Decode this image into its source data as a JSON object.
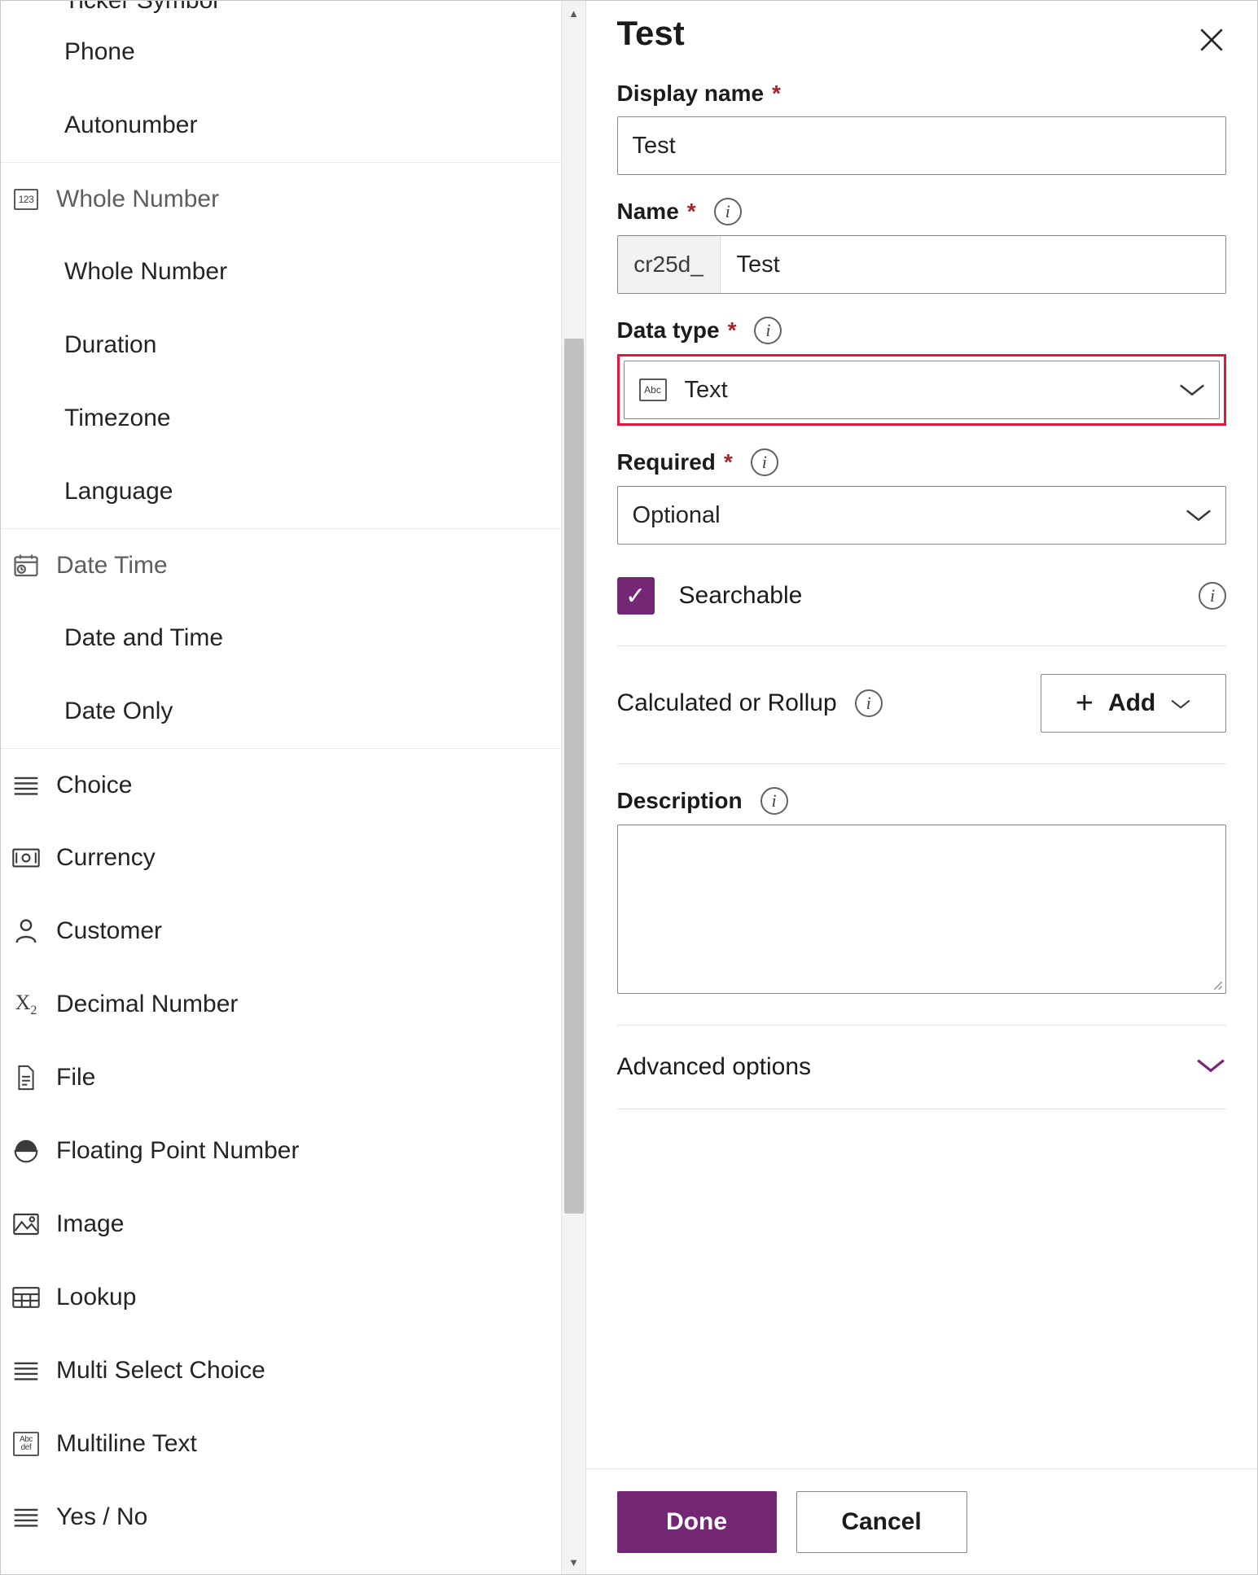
{
  "colors": {
    "accent": "#742774",
    "highlight": "#e3173e",
    "required_star": "#a4262c",
    "group_header_text": "#5e5e5e",
    "border": "#8a8886"
  },
  "left_list": {
    "name": "data-type-list",
    "partial_top_item": "Ticker Symbol",
    "sections": [
      {
        "items": [
          {
            "label": "Phone",
            "indent": true
          },
          {
            "label": "Autonumber",
            "indent": true
          }
        ]
      },
      {
        "header": {
          "label": "Whole Number",
          "icon": "whole-number-icon",
          "glyph": "123"
        },
        "items": [
          {
            "label": "Whole Number",
            "indent": true
          },
          {
            "label": "Duration",
            "indent": true
          },
          {
            "label": "Timezone",
            "indent": true
          },
          {
            "label": "Language",
            "indent": true
          }
        ]
      },
      {
        "header": {
          "label": "Date Time",
          "icon": "date-time-icon",
          "glyph": "cal"
        },
        "items": [
          {
            "label": "Date and Time",
            "indent": true
          },
          {
            "label": "Date Only",
            "indent": true
          }
        ]
      },
      {
        "items": [
          {
            "label": "Choice",
            "icon": "choice-list-icon"
          },
          {
            "label": "Currency",
            "icon": "currency-icon"
          },
          {
            "label": "Customer",
            "icon": "customer-person-icon"
          },
          {
            "label": "Decimal Number",
            "icon": "decimal-number-icon"
          },
          {
            "label": "File",
            "icon": "file-icon"
          },
          {
            "label": "Floating Point Number",
            "icon": "floating-point-icon"
          },
          {
            "label": "Image",
            "icon": "image-icon"
          },
          {
            "label": "Lookup",
            "icon": "lookup-icon"
          },
          {
            "label": "Multi Select Choice",
            "icon": "multi-select-choice-icon"
          },
          {
            "label": "Multiline Text",
            "icon": "multiline-text-icon"
          },
          {
            "label": "Yes / No",
            "icon": "yes-no-icon"
          }
        ]
      }
    ],
    "scrollbar": {
      "up_arrow": "▲",
      "down_arrow": "▼"
    }
  },
  "panel": {
    "title": "Test",
    "close_icon": "close-icon",
    "display_name": {
      "label": "Display name",
      "required_marker": "*",
      "value": "Test"
    },
    "name": {
      "label": "Name",
      "required_marker": "*",
      "info_icon": "info-icon",
      "prefix": "cr25d_",
      "value": "Test"
    },
    "data_type": {
      "label": "Data type",
      "required_marker": "*",
      "info_icon": "info-icon",
      "selected": "Text",
      "selected_icon": "abc-text-icon",
      "selected_glyph": "Abc",
      "chevron": "chevron-down-icon",
      "highlighted": true
    },
    "required_field": {
      "label": "Required",
      "required_marker": "*",
      "info_icon": "info-icon",
      "selected": "Optional",
      "chevron": "chevron-down-icon"
    },
    "searchable": {
      "label": "Searchable",
      "checked": true,
      "check_glyph": "✓",
      "info_icon": "info-icon"
    },
    "calculated_or_rollup": {
      "label": "Calculated or Rollup",
      "info_icon": "info-icon",
      "add_button": "Add",
      "add_plus": "+",
      "add_chevron": "chevron-down-icon"
    },
    "description": {
      "label": "Description",
      "info_icon": "info-icon",
      "value": "",
      "placeholder": ""
    },
    "advanced_options": {
      "label": "Advanced options",
      "chevron": "chevron-down-icon"
    },
    "footer": {
      "done": "Done",
      "cancel": "Cancel"
    }
  }
}
